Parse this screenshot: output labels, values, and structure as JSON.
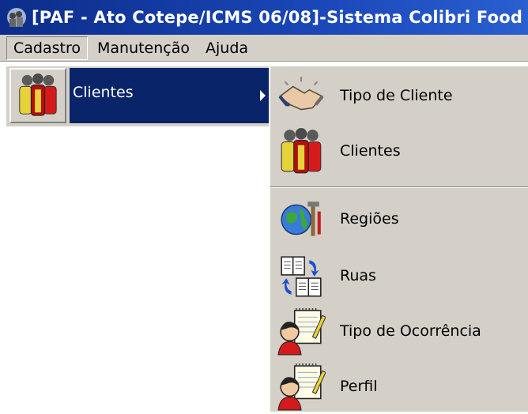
{
  "window": {
    "title": "[PAF - Ato Cotepe/ICMS 06/08]-Sistema Colibri Food",
    "app_icon": "colibri-app-icon"
  },
  "menubar": {
    "items": [
      {
        "label": "Cadastro",
        "active": true
      },
      {
        "label": "Manutenção",
        "active": false
      },
      {
        "label": "Ajuda",
        "active": false
      }
    ]
  },
  "cadastro_menu": {
    "items": [
      {
        "label": "Clientes",
        "icon": "people-group-icon",
        "has_submenu": true,
        "highlighted": true
      }
    ]
  },
  "clientes_submenu": {
    "items": [
      {
        "label": "Tipo de Cliente",
        "icon": "handshake-icon"
      },
      {
        "label": "Clientes",
        "icon": "people-group-icon"
      },
      {
        "label": "Regiões",
        "icon": "globe-tools-icon"
      },
      {
        "label": "Ruas",
        "icon": "book-arrows-icon"
      },
      {
        "label": "Tipo de Ocorrência",
        "icon": "person-notepad-icon"
      },
      {
        "label": "Perfil",
        "icon": "person-notepad-icon"
      }
    ]
  },
  "colors": {
    "title_bar": "#0c2d8a",
    "menu_face": "#d4d0c8",
    "highlight": "#0a246a"
  }
}
